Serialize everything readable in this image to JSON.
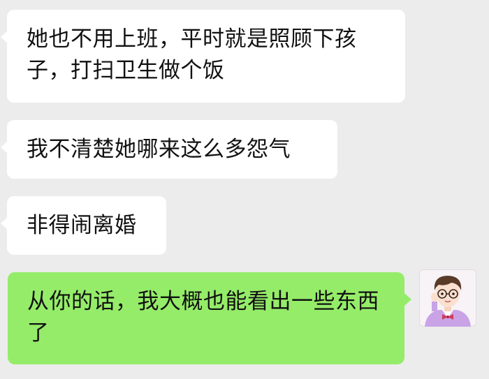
{
  "chat": {
    "messages": [
      {
        "direction": "incoming",
        "text": "她也不用上班，平时就是照顾下孩子，打扫卫生做个饭"
      },
      {
        "direction": "incoming",
        "text": "我不清楚她哪来这么多怨气"
      },
      {
        "direction": "incoming",
        "text": "非得闹离婚"
      },
      {
        "direction": "outgoing",
        "text": "从你的话，我大概也能看出一些东西了"
      }
    ],
    "avatar": {
      "icon": "cartoon-man-with-glasses-avatar"
    }
  },
  "colors": {
    "background": "#ececec",
    "incoming_bubble": "#ffffff",
    "outgoing_bubble": "#95ec69",
    "text": "#111111"
  }
}
